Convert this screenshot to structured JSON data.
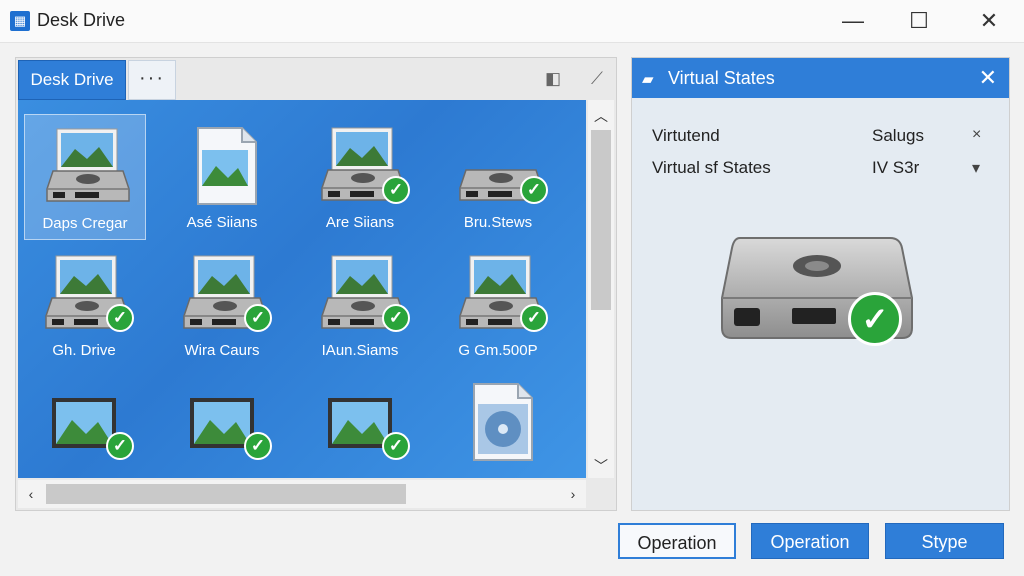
{
  "window": {
    "title": "Desk Drive",
    "controls": [
      "minimize",
      "maximize",
      "close"
    ]
  },
  "left_panel": {
    "tabs": [
      {
        "label": "Desk Drive",
        "active": true
      },
      {
        "label": "···",
        "active": false
      }
    ],
    "toolbar_icons": [
      "panel-icon",
      "edit-icon"
    ],
    "items": [
      {
        "label": "Daps Cregar",
        "kind": "image-drive",
        "checked": false,
        "selected": true
      },
      {
        "label": "Asé Siians",
        "kind": "image-file",
        "checked": false,
        "selected": false
      },
      {
        "label": "Are Siians",
        "kind": "image-drive",
        "checked": true,
        "selected": false
      },
      {
        "label": "Bru.Stews",
        "kind": "drive",
        "checked": true,
        "selected": false
      },
      {
        "label": "Gh. Drive",
        "kind": "image-drive",
        "checked": true,
        "selected": false
      },
      {
        "label": "Wira Caurs",
        "kind": "image-drive",
        "checked": true,
        "selected": false
      },
      {
        "label": "IAun.Siams",
        "kind": "image-drive",
        "checked": true,
        "selected": false
      },
      {
        "label": "G Gm.500P",
        "kind": "image-drive",
        "checked": true,
        "selected": false
      },
      {
        "label": "",
        "kind": "image",
        "checked": true,
        "selected": false
      },
      {
        "label": "",
        "kind": "image",
        "checked": true,
        "selected": false
      },
      {
        "label": "",
        "kind": "image",
        "checked": true,
        "selected": false
      },
      {
        "label": "",
        "kind": "disc-file",
        "checked": false,
        "selected": false
      }
    ]
  },
  "right_panel": {
    "title": "Virtual States",
    "properties": [
      {
        "name": "Virtutend",
        "value": "Salugs",
        "control": "×"
      },
      {
        "name": "Virtual sf States",
        "value": "IV S3r",
        "control": "▾"
      }
    ],
    "status": "checked"
  },
  "buttons": {
    "operation_1": "Operation",
    "operation_2": "Operation",
    "stype": "Stype"
  },
  "colors": {
    "accent": "#2f7ed8",
    "check": "#2aa43a"
  }
}
